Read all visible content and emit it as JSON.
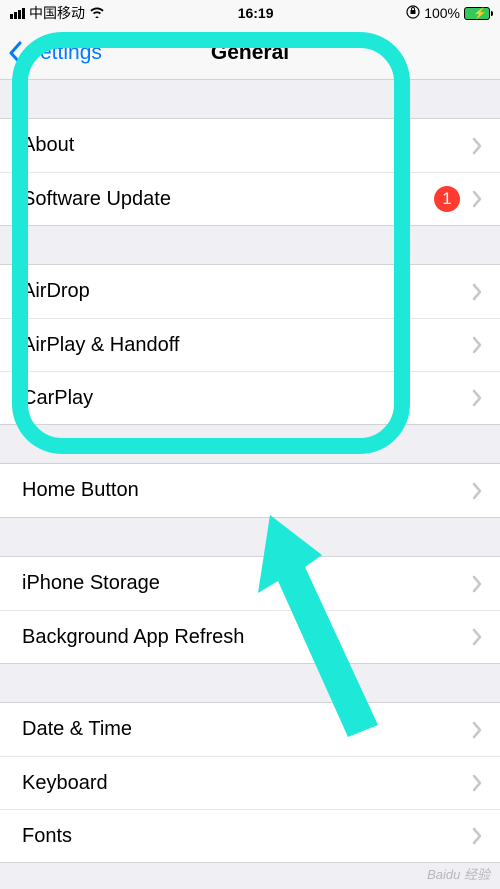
{
  "statusBar": {
    "carrier": "中国移动",
    "time": "16:19",
    "batteryPercent": "100%"
  },
  "nav": {
    "backLabel": "Settings",
    "title": "General"
  },
  "groups": [
    {
      "rows": [
        {
          "label": "About",
          "badge": null
        },
        {
          "label": "Software Update",
          "badge": "1"
        }
      ]
    },
    {
      "rows": [
        {
          "label": "AirDrop",
          "badge": null
        },
        {
          "label": "AirPlay & Handoff",
          "badge": null
        },
        {
          "label": "CarPlay",
          "badge": null
        }
      ]
    },
    {
      "rows": [
        {
          "label": "Home Button",
          "badge": null
        }
      ]
    },
    {
      "rows": [
        {
          "label": "iPhone Storage",
          "badge": null
        },
        {
          "label": "Background App Refresh",
          "badge": null
        }
      ]
    },
    {
      "rows": [
        {
          "label": "Date & Time",
          "badge": null
        },
        {
          "label": "Keyboard",
          "badge": null
        },
        {
          "label": "Fonts",
          "badge": null
        }
      ]
    }
  ],
  "annotation": {
    "highlightColor": "#1ee8d8"
  },
  "watermark": "Baidu 经验"
}
